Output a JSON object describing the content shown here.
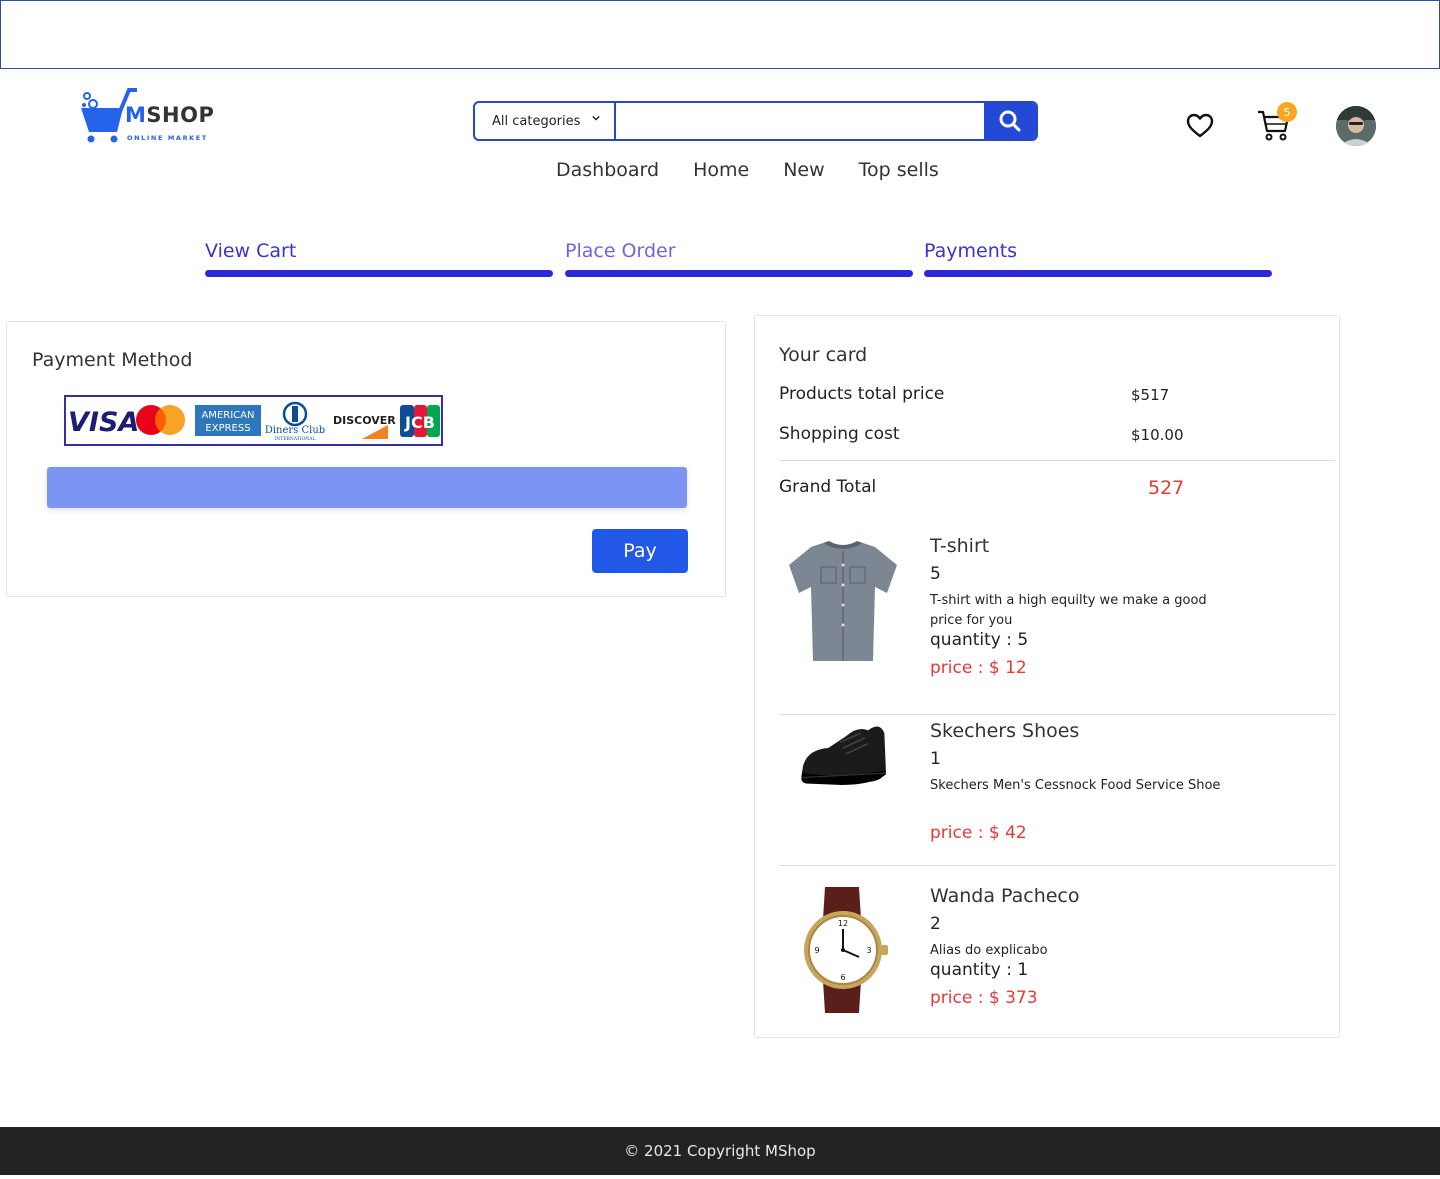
{
  "brand": {
    "name_accent": "M",
    "name_rest": "SHOP",
    "tagline": "ONLINE MARKET",
    "color": "#2563eb"
  },
  "search": {
    "category": "All categories",
    "value": "",
    "placeholder": ""
  },
  "nav": [
    "Dashboard",
    "Home",
    "New",
    "Top sells"
  ],
  "header_icons": {
    "wishlist": "heart-icon",
    "cart": "cart-icon",
    "cart_count": "5",
    "profile": "avatar"
  },
  "steps": [
    {
      "label": "View Cart"
    },
    {
      "label": "Place Order"
    },
    {
      "label": "Payments"
    }
  ],
  "payment": {
    "title": "Payment Method",
    "accepted_cards": [
      "VISA",
      "Mastercard",
      "American Express",
      "Diners Club",
      "DISCOVER",
      "JCB"
    ],
    "card_text": {
      "visa": "VISA",
      "amex_top": "AMERICAN",
      "amex_bottom": "EXPRESS",
      "diners": "Diners Club",
      "diners_sub": "INTERNATIONAL",
      "discover": "DISCOVER",
      "jcb": "JCB"
    },
    "pay_label": "Pay"
  },
  "summary": {
    "title": "Your card",
    "products_label": "Products total price",
    "products_value": "$517",
    "shipping_label": "Shopping cost",
    "shipping_value": "$10.00",
    "grand_label": "Grand Total",
    "grand_value": "527"
  },
  "items": [
    {
      "name": "T-shirt",
      "count": "5",
      "description": "T-shirt with a high equilty we make a good price for you",
      "quantity": "quantity : 5",
      "price": "price : $ 12"
    },
    {
      "name": "Skechers Shoes",
      "count": "1",
      "description": "Skechers Men's Cessnock Food Service Shoe",
      "quantity": "",
      "price": "price : $ 42"
    },
    {
      "name": "Wanda Pacheco",
      "count": "2",
      "description": "Alias do explicabo",
      "quantity": "quantity : 1",
      "price": "price : $ 373"
    }
  ],
  "footer": {
    "text": "© 2021 Copyright MShop"
  },
  "colors": {
    "primary": "#2449d6",
    "step_bar": "#2f26d9",
    "price_red": "#e53935",
    "card_field": "#7b95f2",
    "footer_bg": "#232323",
    "badge": "#f5a623"
  }
}
